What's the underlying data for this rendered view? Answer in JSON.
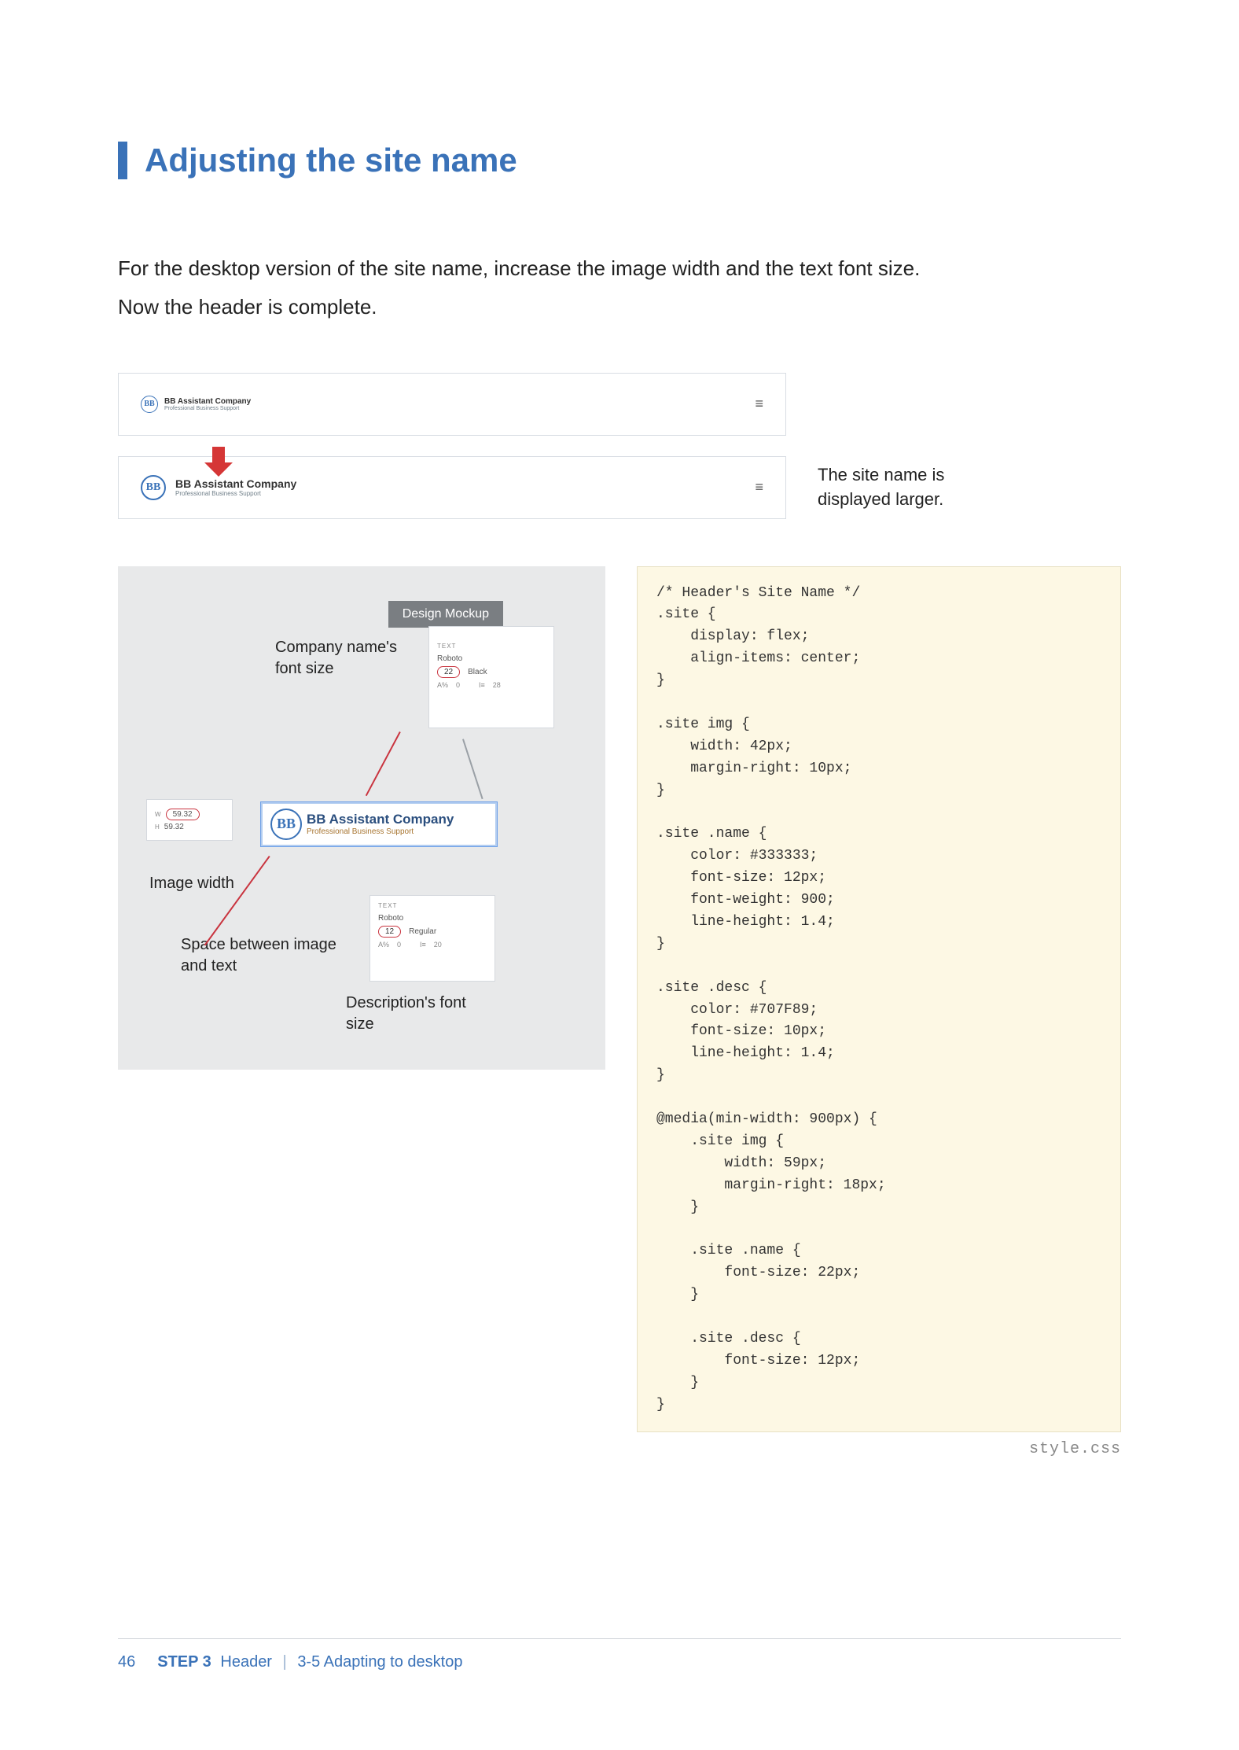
{
  "title": "Adjusting the site name",
  "intro": {
    "p1": "For the desktop version of the site name, increase the image width and the text font size.",
    "p2": "Now the header is complete."
  },
  "header_preview": {
    "company_name": "BB Assistant Company",
    "company_desc": "Professional Business Support",
    "logo_text": "BB"
  },
  "side_note": "The site name is displayed larger.",
  "mockup": {
    "tab": "Design Mockup",
    "labels": {
      "company_fs": "Company name's font size",
      "img_width": "Image width",
      "space": "Space between image and text",
      "desc_fs": "Description's font size"
    },
    "panel_text_hdr": "TEXT",
    "panel_font": "Roboto",
    "top_size": "22",
    "top_weight": "Black",
    "top_letter": "0",
    "top_line": "28",
    "bot_size": "12",
    "bot_weight": "Regular",
    "bot_letter": "0",
    "bot_line": "20",
    "w_label": "W",
    "w1": "59.32",
    "h_label": "H",
    "h1": "59.32"
  },
  "code": "/* Header's Site Name */\n.site {\n    display: flex;\n    align-items: center;\n}\n\n.site img {\n    width: 42px;\n    margin-right: 10px;\n}\n\n.site .name {\n    color: #333333;\n    font-size: 12px;\n    font-weight: 900;\n    line-height: 1.4;\n}\n\n.site .desc {\n    color: #707F89;\n    font-size: 10px;\n    line-height: 1.4;\n}\n\n@media(min-width: 900px) {\n    .site img {\n        width: 59px;\n        margin-right: 18px;\n    }\n\n    .site .name {\n        font-size: 22px;\n    }\n\n    .site .desc {\n        font-size: 12px;\n    }\n}",
  "code_caption": "style.css",
  "footer": {
    "page": "46",
    "step": "STEP 3",
    "section": "Header",
    "sub": "3-5  Adapting to desktop"
  }
}
